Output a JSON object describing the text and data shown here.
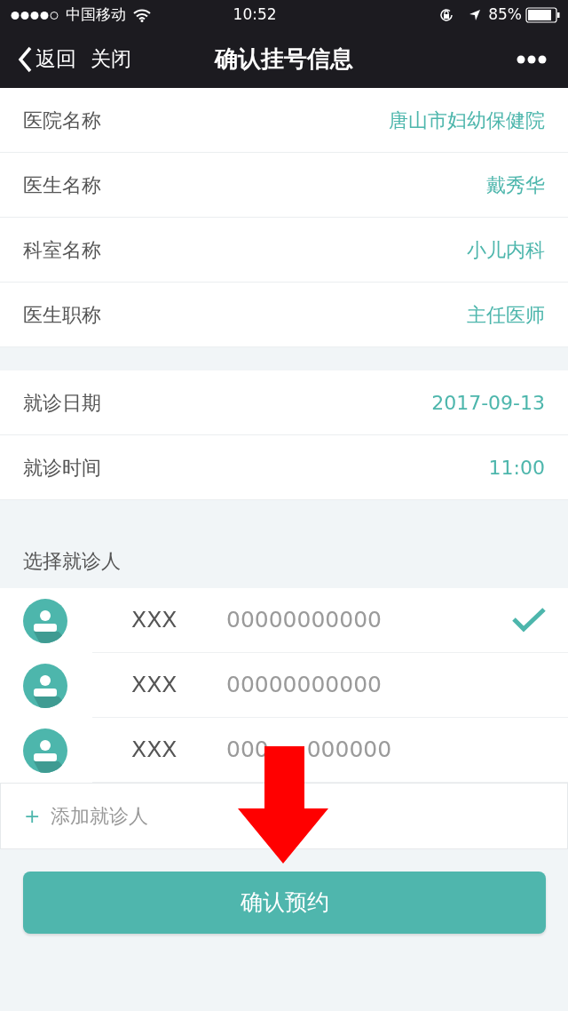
{
  "status_bar": {
    "carrier": "中国移动",
    "time": "10:52",
    "battery": "85%"
  },
  "nav": {
    "back": "返回",
    "close": "关闭",
    "title": "确认挂号信息"
  },
  "sections": [
    {
      "rows": [
        {
          "label": "医院名称",
          "value": "唐山市妇幼保健院"
        },
        {
          "label": "医生名称",
          "value": "戴秀华"
        },
        {
          "label": "科室名称",
          "value": "小儿内科"
        },
        {
          "label": "医生职称",
          "value": "主任医师"
        }
      ]
    },
    {
      "rows": [
        {
          "label": "就诊日期",
          "value": "2017-09-13"
        },
        {
          "label": "就诊时间",
          "value": "11:00"
        }
      ]
    }
  ],
  "patients_header": "选择就诊人",
  "patients": [
    {
      "name": "XXX",
      "phone_parts": [
        "00000000000"
      ],
      "selected": true
    },
    {
      "name": "XXX",
      "phone_parts": [
        "00000000000"
      ],
      "selected": false
    },
    {
      "name": "XXX",
      "phone_parts": [
        "000",
        "000000"
      ],
      "selected": false
    }
  ],
  "add_patient": {
    "icon": "+",
    "label": "添加就诊人"
  },
  "confirm_button": "确认预约"
}
